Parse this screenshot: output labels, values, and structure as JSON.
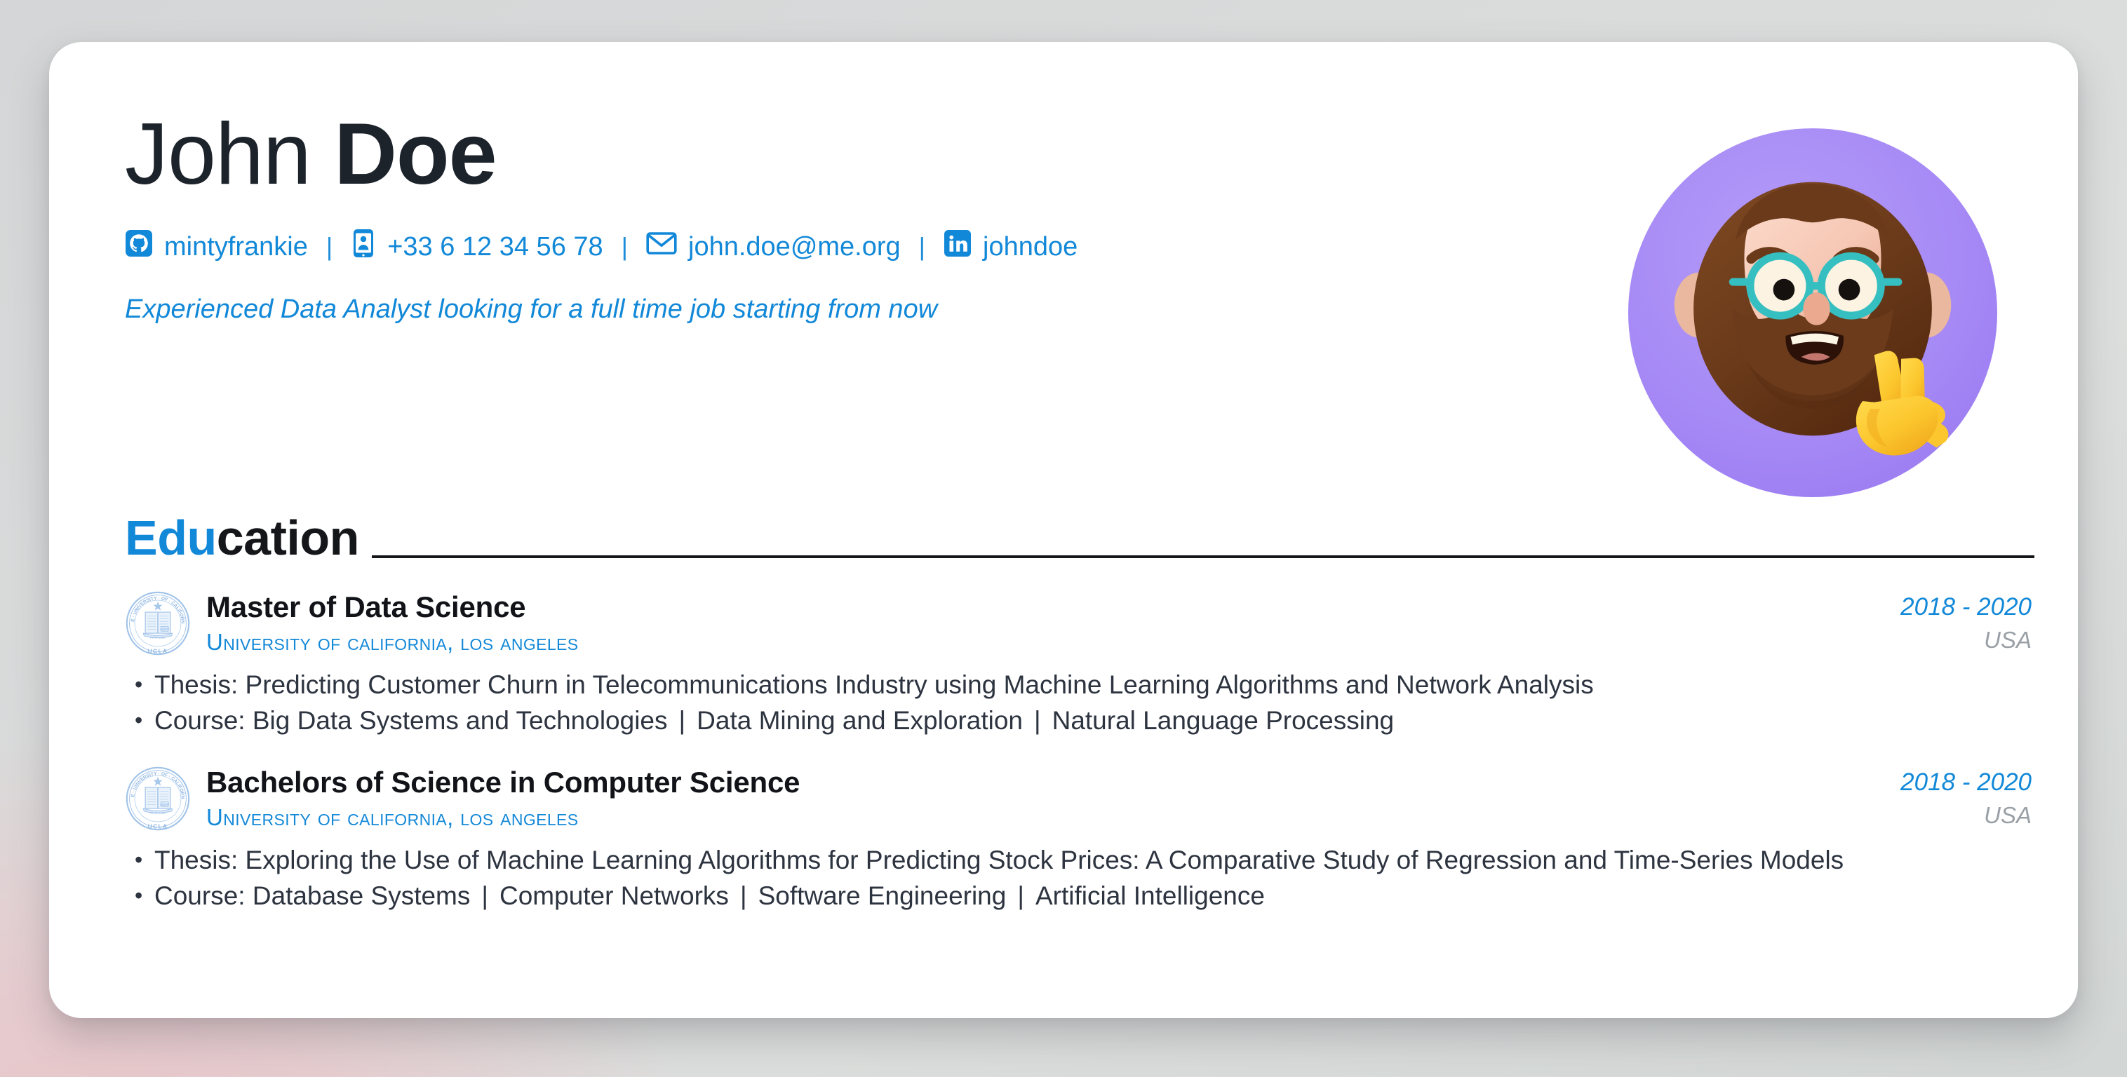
{
  "page": {
    "background_gradient_from": "#d4d6d7",
    "background_accent_pink": "#e9c6ca",
    "card_background": "#ffffff"
  },
  "theme": {
    "accent_blue": "#1288d8",
    "text_dark": "#1d232b",
    "body_text": "#2d3440",
    "muted_gray": "#9aa0a6",
    "avatar_purple": "#a588f5"
  },
  "header": {
    "first_name": "John",
    "last_name": "Doe",
    "tagline": "Experienced Data Analyst looking for a full time job starting from now",
    "avatar": {
      "icon": "memoji-avatar",
      "description": "bearded man with teal round glasses making a peace sign"
    },
    "separator": "|",
    "contacts": [
      {
        "icon": "github-icon",
        "label": "mintyfrankie"
      },
      {
        "icon": "phone-icon",
        "label": "+33 6 12 34 56 78"
      },
      {
        "icon": "email-icon",
        "label": "john.doe@me.org"
      },
      {
        "icon": "linkedin-icon",
        "label": "johndoe"
      }
    ]
  },
  "sections": [
    {
      "title_accent": "Edu",
      "title_rest": "cation",
      "entries": [
        {
          "logo": "ucla-seal-icon",
          "title": "Master of Data Science",
          "organization": "University of California, Los Angeles",
          "date": "2018 - 2020",
          "location": "USA",
          "bullets": [
            {
              "text": "Thesis: Predicting Customer Churn in Telecommunications Industry using Machine Learning Algorithms and Network Analysis"
            },
            {
              "prefix": "Course: ",
              "items": [
                "Big Data Systems and Technologies",
                "Data Mining and Exploration",
                "Natural Language Processing"
              ]
            }
          ]
        },
        {
          "logo": "ucla-seal-icon",
          "title": "Bachelors of Science in Computer Science",
          "organization": "University of California, Los Angeles",
          "date": "2018 - 2020",
          "location": "USA",
          "bullets": [
            {
              "text": "Thesis: Exploring the Use of Machine Learning Algorithms for Predicting Stock Prices: A Comparative Study of Regression and Time-Series Models"
            },
            {
              "prefix": "Course: ",
              "items": [
                "Database Systems",
                "Computer Networks",
                "Software Engineering",
                "Artificial Intelligence"
              ]
            }
          ]
        }
      ]
    }
  ]
}
